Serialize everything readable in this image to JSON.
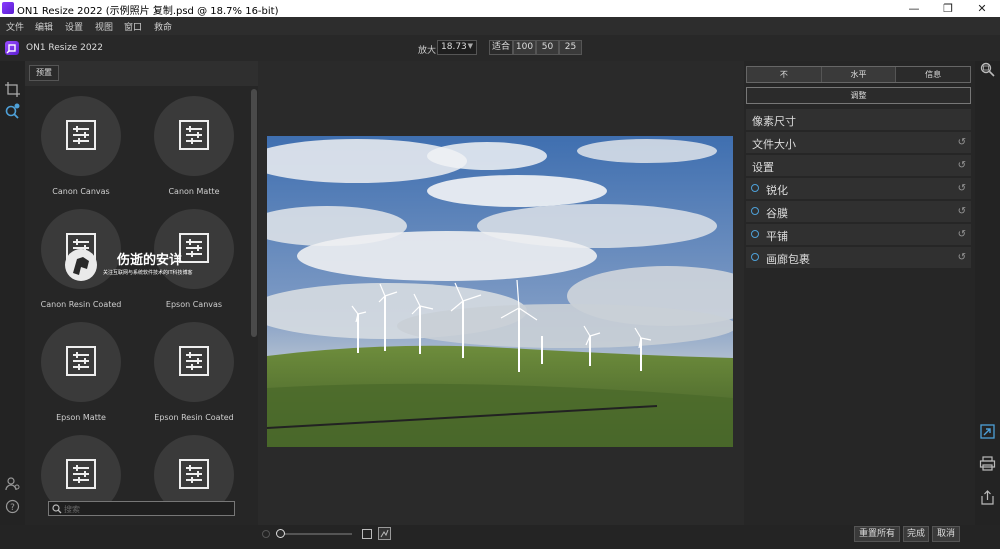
{
  "window": {
    "title": "ON1 Resize 2022 (示例照片 复制.psd @ 18.7% 16-bit)",
    "minimize_glyph": "—",
    "maximize_glyph": "❐",
    "close_glyph": "✕"
  },
  "menu": [
    "文件",
    "编辑",
    "设置",
    "视图",
    "窗口",
    "救命"
  ],
  "app": {
    "name": "ON1 Resize 2022"
  },
  "zoom": {
    "label": "放大",
    "value": "18.73",
    "fit_label": "适合",
    "presets": [
      "100",
      "50",
      "25"
    ]
  },
  "presets_panel": {
    "tab_label": "预置",
    "items": [
      {
        "label": "Canon Canvas"
      },
      {
        "label": "Canon Matte"
      },
      {
        "label": "Canon Resin Coated"
      },
      {
        "label": "Epson Canvas"
      },
      {
        "label": "Epson Matte"
      },
      {
        "label": "Epson Resin Coated"
      },
      {
        "label": ""
      },
      {
        "label": ""
      }
    ],
    "search_placeholder": "搜索"
  },
  "watermark": {
    "title": "伤逝的安详",
    "subtitle": "关注互联网与系统软件技术的IT科技博客"
  },
  "right_panel": {
    "segments": [
      "不",
      "水平",
      "信息"
    ],
    "adjust_label": "调整",
    "sections": [
      {
        "label": "像素尺寸",
        "reset": false,
        "toggle": false
      },
      {
        "label": "文件大小",
        "reset": true,
        "toggle": false
      },
      {
        "label": "设置",
        "reset": true,
        "toggle": false
      },
      {
        "label": "锐化",
        "reset": true,
        "toggle": true
      },
      {
        "label": "谷膜",
        "reset": true,
        "toggle": true
      },
      {
        "label": "平铺",
        "reset": true,
        "toggle": true
      },
      {
        "label": "画廊包裹",
        "reset": true,
        "toggle": true
      }
    ]
  },
  "bottom": {
    "reset_all": "重置所有",
    "done": "完成",
    "cancel": "取消"
  },
  "colors": {
    "accent": "#4ea0d8",
    "brand": "#7a2cf0"
  }
}
